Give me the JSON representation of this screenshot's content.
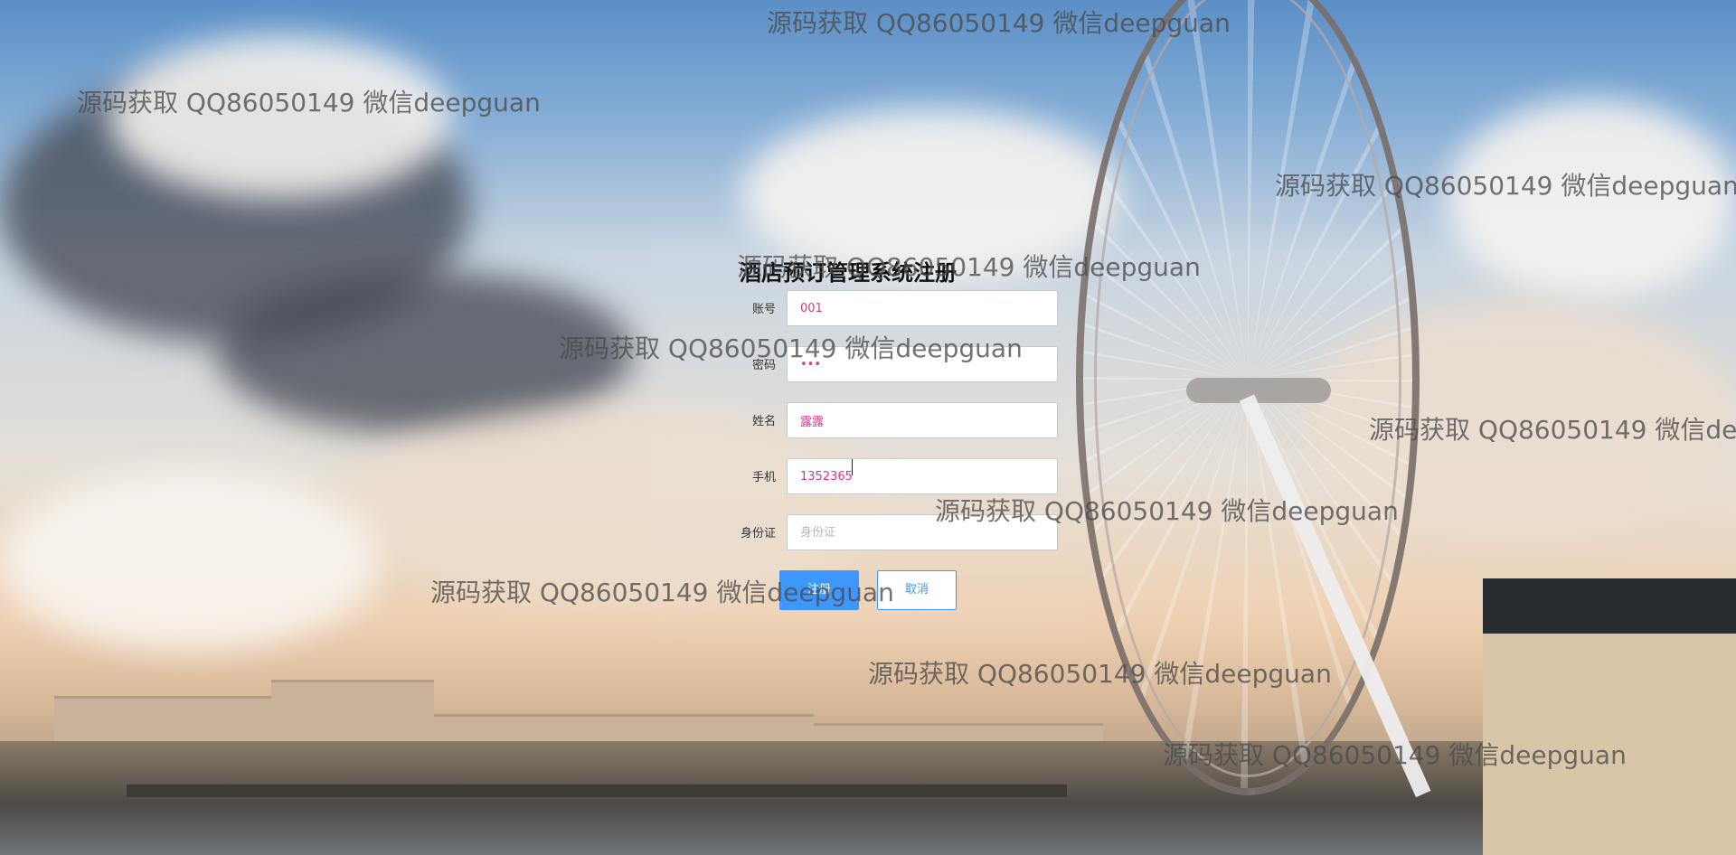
{
  "form": {
    "title": "酒店预订管理系统注册",
    "fields": [
      {
        "label": "账号",
        "value": "001",
        "placeholder": ""
      },
      {
        "label": "密码",
        "value": "•••",
        "placeholder": ""
      },
      {
        "label": "姓名",
        "value": "露露",
        "placeholder": ""
      },
      {
        "label": "手机",
        "value": "1352365",
        "placeholder": ""
      },
      {
        "label": "身份证",
        "value": "",
        "placeholder": "身份证"
      }
    ],
    "submit_label": "注册",
    "cancel_label": "取消"
  },
  "watermark": {
    "text": "源码获取 QQ86050149 微信deepguan"
  },
  "colors": {
    "accent": "#3d97ff",
    "input_text": "#e0348b"
  }
}
